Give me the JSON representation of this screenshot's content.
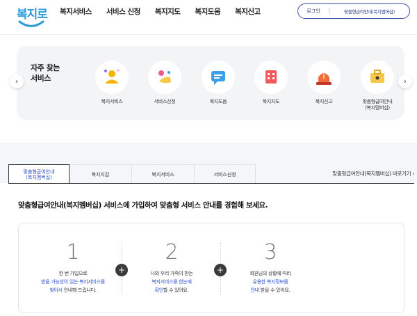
{
  "brand": {
    "logo_text": "복지로"
  },
  "nav": [
    "복지서비스",
    "서비스 신청",
    "복지지도",
    "복지도움",
    "복지신고"
  ],
  "header_buttons": {
    "login": "로그인",
    "membership": "맞춤형급여안내(복지멤버십)"
  },
  "quick": {
    "title_line1": "자주 찾는",
    "title_line2": "서비스",
    "items": [
      {
        "label": "복지서비스",
        "icon": "person-icon",
        "color": "#f4b400"
      },
      {
        "label": "서비스신청",
        "icon": "hand-icon",
        "color": "#f7a8c2"
      },
      {
        "label": "복지도움",
        "icon": "chat-icon",
        "color": "#3aa0e8"
      },
      {
        "label": "복지지도",
        "icon": "map-building-icon",
        "color": "#f05a5a"
      },
      {
        "label": "복지신고",
        "icon": "siren-icon",
        "color": "#f26b3a"
      },
      {
        "label_line1": "맞춤형급여안내",
        "label_line2": "(복지멤버십)",
        "icon": "briefcase-icon",
        "color": "#f6c94a"
      }
    ],
    "prev": "‹",
    "next": "›"
  },
  "tabs": [
    {
      "line1": "맞춤형급여안내",
      "line2": "(복지멤버십)",
      "active": true
    },
    {
      "label": "복지지갑"
    },
    {
      "label": "복지서비스"
    },
    {
      "label": "서비스신청"
    }
  ],
  "shortcut": "맞춤형급여안내(복지멤버십) 바로가기 ›",
  "intro": "맞춤형급여안내(복지멤버십) 서비스에 가입하여 맞춤형 서비스 안내를 경험해 보세요.",
  "steps": [
    {
      "num": "1",
      "l1": "한 번 가입으로",
      "l2": "받을 가능성이 있는 복지서비스를",
      "l3a": "찾아서",
      "l3b": " 안내해 드립니다."
    },
    {
      "num": "2",
      "l1": "나와 우리 가족이 받는",
      "l2": "복지서비스를 한눈에",
      "l3a": "확인",
      "l3b": "할 수 있어요."
    },
    {
      "num": "3",
      "l1": "회원님의 상황에 따라",
      "l2": "유용한 복지정보를",
      "l3a": "안내",
      "l3b": " 받을 수 있어요."
    }
  ],
  "plus": "+",
  "colors": {
    "accent": "#2a4fd1",
    "brand": "#2a9ad8",
    "panel": "#f3f4f6"
  }
}
